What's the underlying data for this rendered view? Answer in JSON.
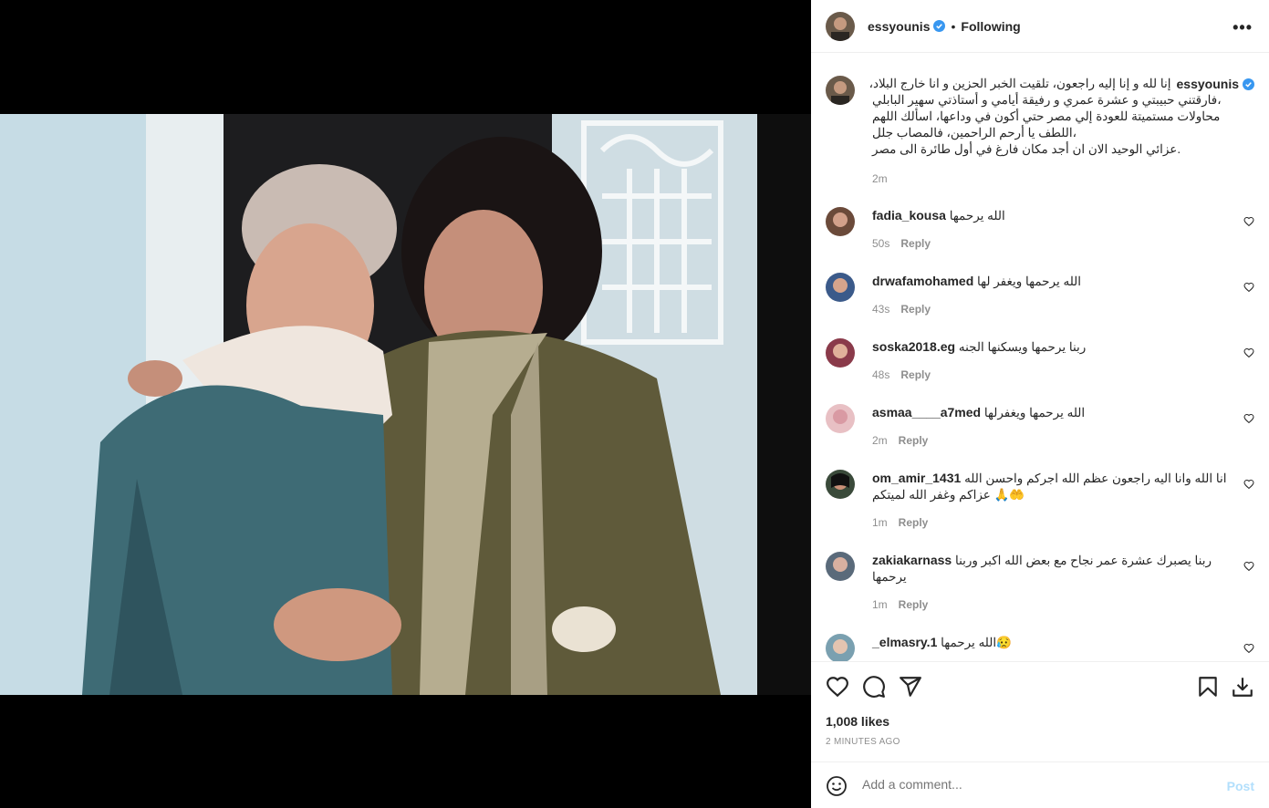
{
  "post": {
    "username": "essyounis",
    "dot": "•",
    "follow_status": "Following",
    "more": "•••"
  },
  "caption": {
    "username": "essyounis",
    "lines": [
      "إنا لله و إنا إليه راجعون، تلقيت الخبر الحزين و انا خارج البلاد،",
      "فارقتني حبيبتي و عشرة عمري و رفيقة أيامي و أستاذتي سهير البابلي،",
      "محاولات مستميتة للعودة إلي مصر حتي أكون في وداعها، اسألك اللهم",
      "اللطف يا أرحم الراحمين، فالمصاب جلل،",
      "عزائي الوحيد الان ان أجد مكان فارغ في أول طائرة الى مصر."
    ],
    "time": "2m"
  },
  "comments": [
    {
      "username": "fadia_kousa",
      "text": "الله يرحمها",
      "time": "50s",
      "reply": "Reply",
      "avatar_color": "#6b4a3a"
    },
    {
      "username": "drwafamohamed",
      "text": "الله يرحمها ويغفر لها",
      "time": "43s",
      "reply": "Reply",
      "avatar_color": "#3b5a8a"
    },
    {
      "username": "soska2018.eg",
      "text": "ربنا يرحمها ويسكنها الجنه",
      "time": "48s",
      "reply": "Reply",
      "avatar_color": "#8a3a4a"
    },
    {
      "username": "asmaa____a7med",
      "text": "الله يرحمها ويغفرلها",
      "time": "2m",
      "reply": "Reply",
      "avatar_color": "#d9a0a8"
    },
    {
      "username": "om_amir_1431",
      "text": "انا الله وانا اليه راجعون عظم الله اجركم واحسن الله",
      "text2": "عزاكم وغفر الله لميتكم 🙏🤲",
      "time": "1m",
      "reply": "Reply",
      "avatar_color": "#2a2a2a"
    },
    {
      "username": "zakiakarnass",
      "text": "ربنا يصبرك عشرة عمر نجاح مع بعض الله اكبر وربنا",
      "text2": "يرحمها",
      "time": "1m",
      "reply": "Reply",
      "avatar_color": "#5a6a7a"
    },
    {
      "username": "_elmasry.1",
      "text": "الله يرحمها😥",
      "time": "",
      "reply": "",
      "avatar_color": "#7aa0b0"
    }
  ],
  "actions": {
    "likes": "1,008 likes",
    "posted": "2 MINUTES AGO",
    "add_placeholder": "Add a comment...",
    "post_label": "Post"
  },
  "colors": {
    "verified": "#3897f0",
    "post_button": "#b2dffc",
    "secondary_text": "#8e8e8e"
  }
}
